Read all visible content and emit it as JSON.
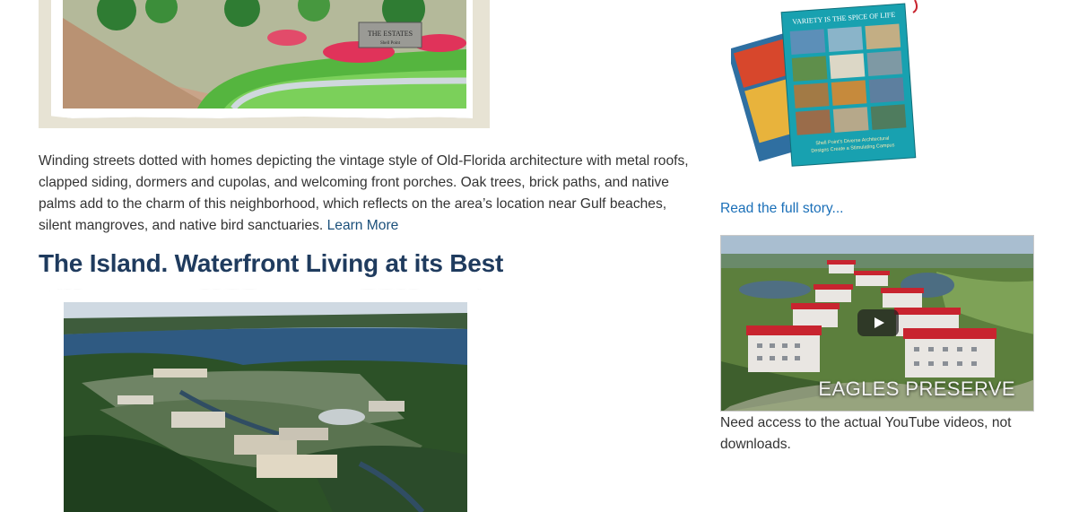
{
  "main": {
    "top_image_alt": "Neighborhood entrance illustration",
    "top_image_sign_line1": "THE ESTATES",
    "top_image_sign_line2": "Shell Point",
    "intro_paragraph": "Winding streets dotted with homes depicting the vintage style of Old-Florida architecture with metal roofs, clapped siding, dormers and cupolas, and welcoming front porches. Oak trees, brick paths, and native palms add to the charm of this neighborhood, which reflects on the area’s location near Gulf beaches, silent mangroves, and native bird sanctuaries.",
    "learn_more_label": "Learn More",
    "section_heading": "The Island. Waterfront Living at its Best"
  },
  "sidebar": {
    "magazine": {
      "headline": "VARIETY IS THE SPICE OF LIFE",
      "caption_line1": "Shell Point’s Diverse Architectural",
      "caption_line2": "Designs Create a Stimulating Campus"
    },
    "read_story_label": "Read the full story...",
    "video": {
      "caption": "EAGLES PRESERVE"
    },
    "video_note": "Need access to the actual YouTube videos, not downloads."
  },
  "colors": {
    "heading": "#1f3b5e",
    "link": "#1a6fb8",
    "body_text": "#333333",
    "roof_red": "#c8242f"
  }
}
